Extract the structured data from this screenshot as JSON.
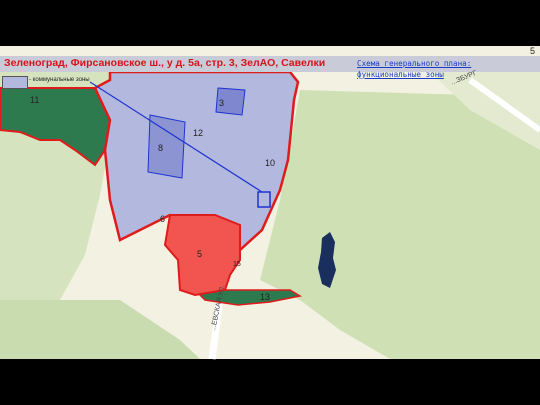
{
  "header": {
    "title": "Зеленоград, Фирсановское ш., у д. 5а, стр. 3, ЗелАО, Савелки",
    "subtitle": "Схема генерального плана: функциональные зоны",
    "page_number": "5"
  },
  "legend": {
    "label": "- коммунальные зоны",
    "swatch_color": "#b3b8de"
  },
  "zones": [
    "11",
    "3",
    "12",
    "8",
    "10",
    "6",
    "5",
    "15",
    "13"
  ],
  "road_labels": [
    "...ЕВСКАЯ УЛ.",
    "...ЗБУРГ"
  ],
  "colors": {
    "communal_zone": "#b3b8de",
    "residential_zone": "#f25450",
    "natural_green": "#2e7a4f",
    "boundary": "#e01b1b",
    "link_line": "#1d34d0",
    "title_text": "#d4141b"
  }
}
